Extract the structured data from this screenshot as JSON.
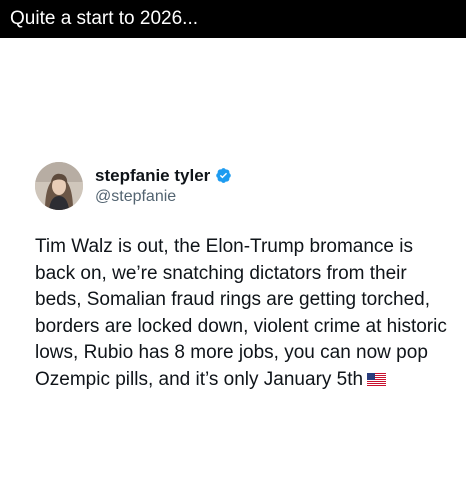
{
  "caption": "Quite a start to 2026...",
  "tweet": {
    "author": {
      "display_name": "stepfanie tyler",
      "handle": "@stepfanie",
      "verified_icon": "verified-badge-icon",
      "avatar": "profile-photo"
    },
    "text": "Tim Walz is out, the Elon-Trump bromance is back on, we’re snatching dictators from their beds, Somalian fraud rings are getting torched, borders are locked down, violent crime at historic lows, Rubio has 8 more jobs, you can now pop Ozempic pills, and it’s only January 5th",
    "trailing_emoji": "us-flag-icon"
  },
  "colors": {
    "caption_bg": "#000000",
    "caption_text": "#ffffff",
    "text_primary": "#0f1419",
    "text_secondary": "#536471",
    "verified_blue": "#1d9bf0"
  }
}
